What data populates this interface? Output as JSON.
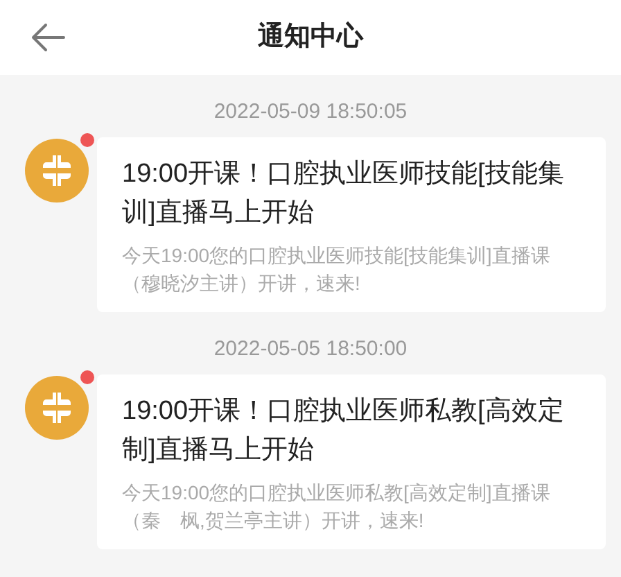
{
  "header": {
    "title": "通知中心"
  },
  "notifications": [
    {
      "time": "2022-05-09 18:50:05",
      "unread": true,
      "title": "19:00开课！口腔执业医师技能[技能集训]直播马上开始",
      "body": "今天19:00您的口腔执业医师技能[技能集训]直播课（穆晓汐主讲）开讲，速来!"
    },
    {
      "time": "2022-05-05 18:50:00",
      "unread": true,
      "title": "19:00开课！口腔执业医师私教[高效定制]直播马上开始",
      "body": "今天19:00您的口腔执业医师私教[高效定制]直播课（秦　枫,贺兰亭主讲）开讲，速来!"
    }
  ]
}
